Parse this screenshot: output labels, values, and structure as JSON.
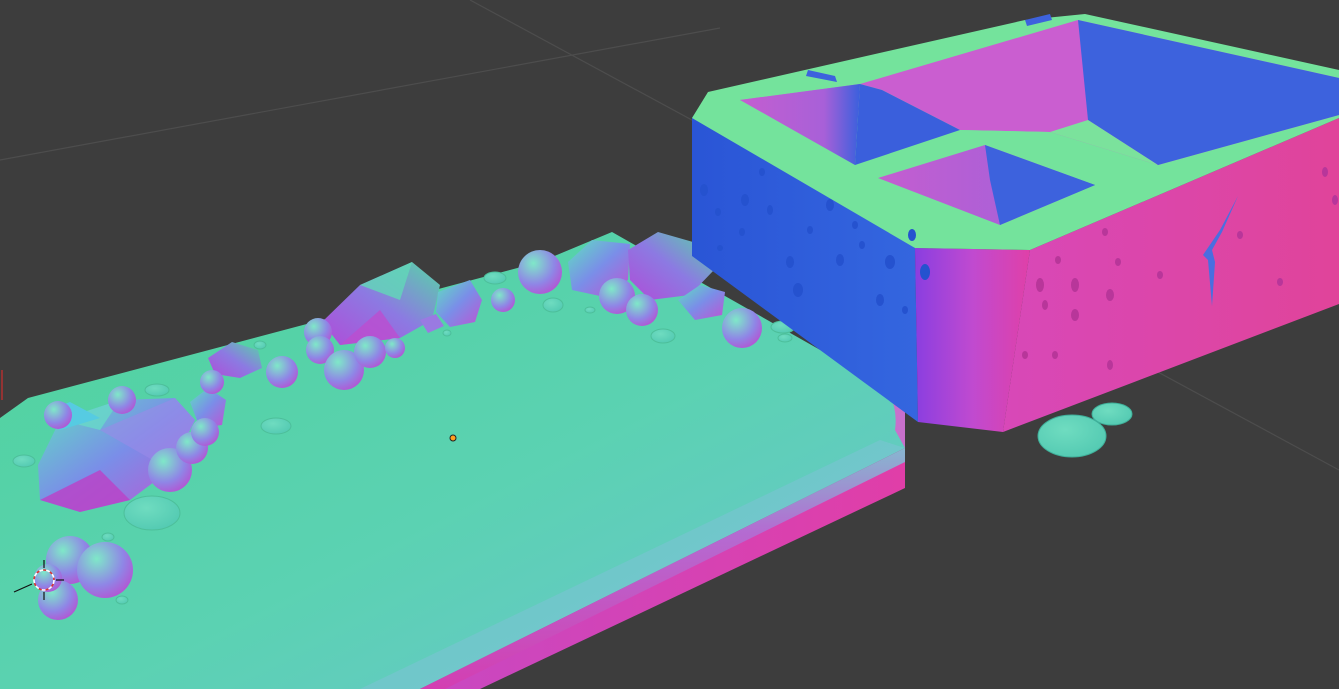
{
  "viewport": {
    "background": "#3d3d3d",
    "grid_color": "#4a4a4a",
    "shading": "normal-map",
    "palette": {
      "top_face": "#5fd1a8",
      "front_face": "#d040b0",
      "left_face": "#2f5fd8",
      "inner_left": "#c85fd0",
      "inner_right": "#3f66dd",
      "rim_light": "#72e59a"
    }
  },
  "objects": [
    {
      "name": "base-slab",
      "type": "mesh"
    },
    {
      "name": "rock-cluster",
      "type": "mesh"
    },
    {
      "name": "open-box",
      "type": "mesh"
    },
    {
      "name": "coin-pieces",
      "type": "mesh"
    }
  ],
  "gizmos": {
    "origin_point": "object-origin",
    "cursor": "3d-cursor"
  }
}
